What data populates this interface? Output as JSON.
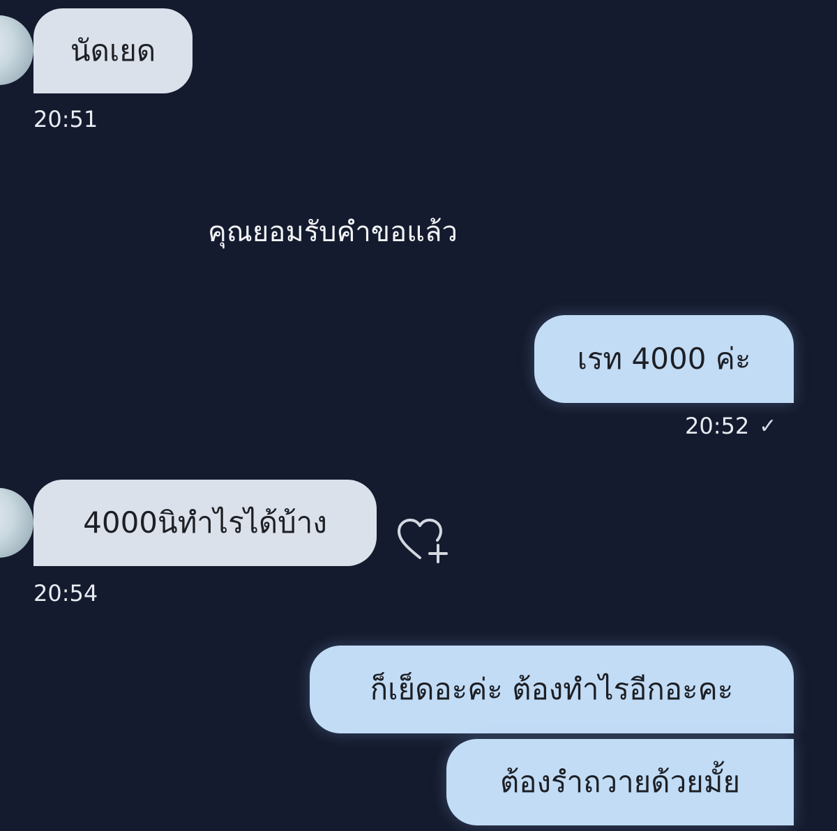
{
  "messages": [
    {
      "side": "in",
      "text": "นัดเยด",
      "time": "20:51"
    },
    {
      "side": "out",
      "text": "เรท 4000 ค่ะ",
      "time": "20:52"
    },
    {
      "side": "in",
      "text": "4000นิทำไรได้บ้าง",
      "time": "20:54"
    },
    {
      "side": "out",
      "text": "ก็เย็ดอะค่ะ ต้องทำไรอีกอะคะ"
    },
    {
      "side": "out",
      "text": "ต้องรำถวายด้วยมั้ย"
    }
  ],
  "system_notice": "คุณยอมรับคำขอแล้ว",
  "read_status_icon": "checkmark-icon",
  "reaction_icon": "heart-plus-icon",
  "colors": {
    "background": "#151b2e",
    "incoming_bubble": "#dbe1ea",
    "outgoing_bubble": "#c2dcf6",
    "text_on_bubble": "#1d1f24",
    "timestamp": "#e9ecf2"
  }
}
